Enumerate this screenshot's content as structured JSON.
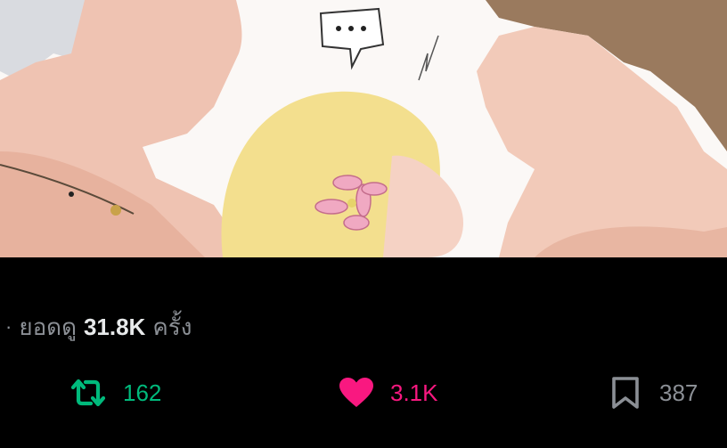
{
  "media": {
    "speech_bubble": "...",
    "alt_hint": "illustration"
  },
  "views": {
    "prefix": "·",
    "label_before": "ยอดดู",
    "count": "31.8K",
    "label_after": "ครั้ง"
  },
  "actions": {
    "retweet": {
      "icon": "retweet-icon",
      "count": "162",
      "color": "#00ba7c"
    },
    "like": {
      "icon": "heart-icon",
      "count": "3.1K",
      "color": "#f91880"
    },
    "bookmark": {
      "icon": "bookmark-icon",
      "count": "387",
      "color": "#8b8f95"
    }
  }
}
